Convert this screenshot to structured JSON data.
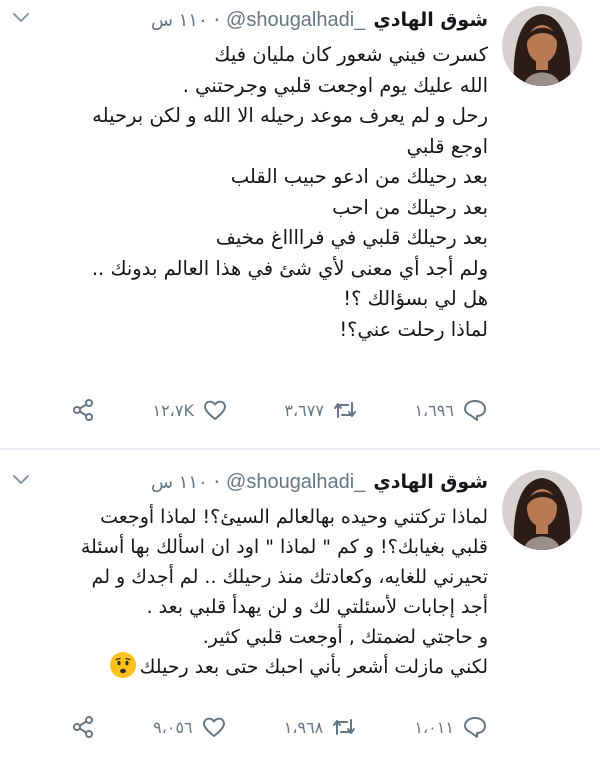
{
  "tweets": [
    {
      "name": "شوق الهادي",
      "handle": "@shougalhadi_",
      "time": "١١٠ س",
      "lines": [
        "كسرت فيني شعور كان مليان فيك",
        "الله عليك يوم اوجعت قلبي وجرحتني .",
        "رحل و لم يعرف موعد رحيله الا الله و لكن برحيله",
        "اوجع قلبي",
        "بعد رحيلك من ادعو حبيب القلب",
        " بعد رحيلك من احب",
        "بعد رحيلك قلبي في فرااااغ مخيف",
        "ولم أجد أي معنى لأي شئ في هذا العالم بدونك ..",
        "هل لي بسؤالك ؟!",
        "لماذا رحلت عني؟!"
      ],
      "replies": "١،٦٩٦",
      "retweets": "٣،٦٧٧",
      "likes": "١٢،٧K"
    },
    {
      "name": "شوق الهادي",
      "handle": "@shougalhadi_",
      "time": "١١٠ س",
      "lines": [
        "لماذا تركتني وحيده بهالعالم السيئ؟! لماذا أوجعت",
        "قلبي بغيابك؟! و كم \" لماذا \" اود ان اسألك بها أسئلة",
        "تحيرني للغايه، وكعادتك منذ رحيلك .. لم أجدك و لم",
        "أجد إجابات لأسئلتي لك و لن يهدأ قلبي بعد .",
        "و حاجتي لضمتك , أوجعت قلبي كثير.",
        "لكني مازلت أشعر بأني احبك حتى بعد رحيلك"
      ],
      "replies": "١،٠١١",
      "retweets": "١،٩٦٨",
      "likes": "٩،٠٥٦"
    }
  ],
  "icons": {
    "reply": "reply-icon",
    "retweet": "retweet-icon",
    "like": "heart-icon",
    "share": "share-icon",
    "more": "chevron-down-icon",
    "emoji": "worried-face-emoji"
  },
  "colors": {
    "text": "#14171a",
    "secondary": "#657786",
    "divider": "#e6ecf0"
  }
}
